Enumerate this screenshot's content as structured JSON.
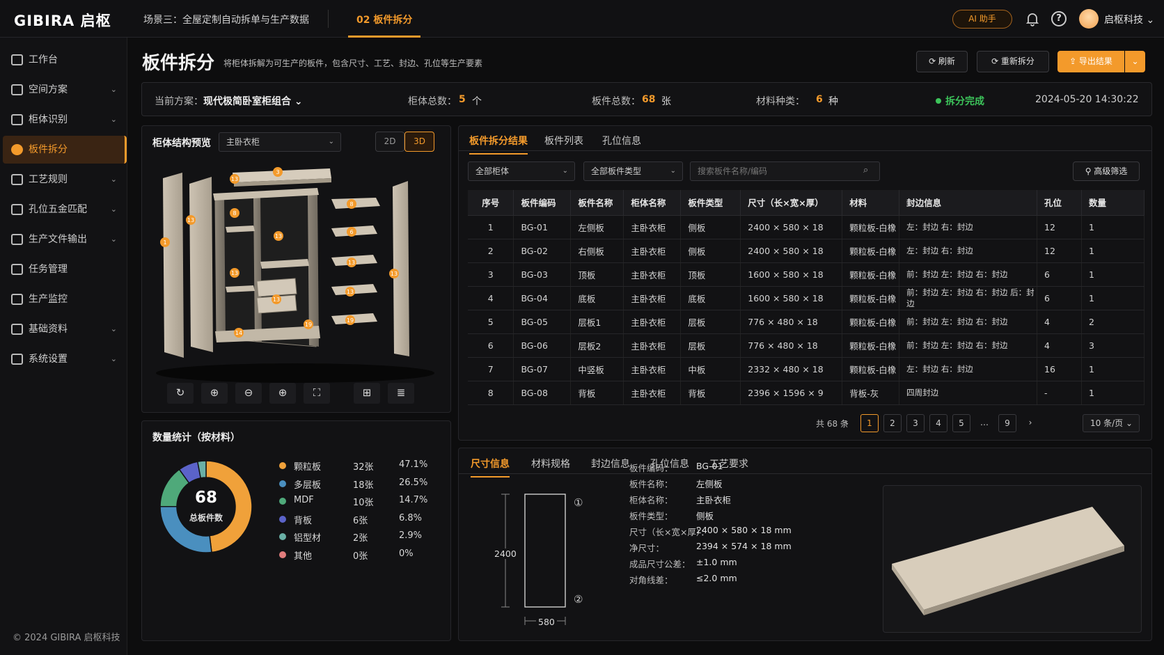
{
  "header": {
    "logo": "GIBIRA 启枢",
    "scene": "场景三：全屋定制自动拆单与生产数据",
    "tab": "02  板件拆分",
    "ai_label": "AI 助手",
    "company": "启枢科技"
  },
  "sidebar": {
    "items": [
      {
        "label": "工作台",
        "chev": ""
      },
      {
        "label": "空间方案",
        "chev": "⌄"
      },
      {
        "label": "柜体识别",
        "chev": "⌄"
      },
      {
        "label": "板件拆分",
        "chev": ""
      },
      {
        "label": "工艺规则",
        "chev": "⌄"
      },
      {
        "label": "孔位五金匹配",
        "chev": "⌄"
      },
      {
        "label": "生产文件输出",
        "chev": "⌄"
      },
      {
        "label": "任务管理",
        "chev": ""
      },
      {
        "label": "生产监控",
        "chev": ""
      },
      {
        "label": "基础资料",
        "chev": "⌄"
      },
      {
        "label": "系统设置",
        "chev": "⌄"
      }
    ],
    "copyright": "© 2024 GIBIRA 启枢科技"
  },
  "page": {
    "title": "板件拆分",
    "desc": "将柜体拆解为可生产的板件，包含尺寸、工艺、封边、孔位等生产要素"
  },
  "toolbar": {
    "refresh": "⟳  刷新",
    "resplit": "⟳  重新拆分",
    "export": "⇪  导出结果",
    "export_more": "⌄"
  },
  "summary": {
    "plan_label": "当前方案：",
    "plan_value": "现代极简卧室柜组合 ⌄",
    "cab_label": "柜体总数：",
    "cab_value": "5",
    "cab_unit": "个",
    "board_label": "板件总数：",
    "board_value": "68",
    "board_unit": "张",
    "mat_label": "材料种类：",
    "mat_value": "6",
    "mat_unit": "种",
    "status": "拆分完成",
    "time": "2024-05-20 14:30:22",
    "status_color": "#3cc35a"
  },
  "preview": {
    "title": "柜体结构预览",
    "select": "主卧衣柜",
    "btn_2d": "2D",
    "btn_3d": "3D",
    "tools": [
      "↻",
      "⊕",
      "⊖",
      "⊕",
      "⛶",
      "⊞",
      "≣"
    ],
    "tags": [
      "3",
      "13",
      "1",
      "13",
      "8",
      "13",
      "8",
      "6",
      "13",
      "13",
      "13",
      "13",
      "19",
      "14",
      "19",
      "13"
    ]
  },
  "stats": {
    "title": "数量统计（按材料）",
    "total": "68",
    "total_label": "总板件数",
    "items": [
      {
        "name": "颗粒板",
        "count": "32张",
        "pct": "47.1%",
        "value": 47.1,
        "color": "#f0a13a"
      },
      {
        "name": "多层板",
        "count": "18张",
        "pct": "26.5%",
        "value": 26.5,
        "color": "#4a8fbf"
      },
      {
        "name": "MDF",
        "count": "10张",
        "pct": "14.7%",
        "value": 14.7,
        "color": "#4fa97a"
      },
      {
        "name": "背板",
        "count": "6张",
        "pct": "6.8%",
        "value": 6.8,
        "color": "#5b63c9"
      },
      {
        "name": "铝型材",
        "count": "2张",
        "pct": "2.9%",
        "value": 2.9,
        "color": "#6ab0a6"
      },
      {
        "name": "其他",
        "count": "0张",
        "pct": "0%",
        "value": 0,
        "color": "#e07c7c"
      }
    ]
  },
  "result": {
    "tabs": [
      "板件拆分结果",
      "板件列表",
      "孔位信息"
    ],
    "filter1": "全部柜体",
    "filter2": "全部板件类型",
    "search_placeholder": "搜索板件名称/编码",
    "adv": "⚲  高级筛选",
    "columns": [
      "序号",
      "板件编码",
      "板件名称",
      "柜体名称",
      "板件类型",
      "尺寸（长×宽×厚）",
      "材料",
      "封边信息",
      "孔位",
      "数量"
    ],
    "rows": [
      [
        "1",
        "BG-01",
        "左侧板",
        "主卧衣柜",
        "侧板",
        "2400 × 580 × 18",
        "颗粒板-白橡",
        "左：封边  右：封边",
        "12",
        "1"
      ],
      [
        "2",
        "BG-02",
        "右侧板",
        "主卧衣柜",
        "侧板",
        "2400 × 580 × 18",
        "颗粒板-白橡",
        "左：封边  右：封边",
        "12",
        "1"
      ],
      [
        "3",
        "BG-03",
        "顶板",
        "主卧衣柜",
        "顶板",
        "1600 × 580 × 18",
        "颗粒板-白橡",
        "前：封边  左：封边  右：封边",
        "6",
        "1"
      ],
      [
        "4",
        "BG-04",
        "底板",
        "主卧衣柜",
        "底板",
        "1600 × 580 × 18",
        "颗粒板-白橡",
        "前：封边 左：封边 右：封边 后：封边",
        "6",
        "1"
      ],
      [
        "5",
        "BG-05",
        "层板1",
        "主卧衣柜",
        "层板",
        "776 × 480 × 18",
        "颗粒板-白橡",
        "前：封边  左：封边  右：封边",
        "4",
        "2"
      ],
      [
        "6",
        "BG-06",
        "层板2",
        "主卧衣柜",
        "层板",
        "776 × 480 × 18",
        "颗粒板-白橡",
        "前：封边  左：封边  右：封边",
        "4",
        "3"
      ],
      [
        "7",
        "BG-07",
        "中竖板",
        "主卧衣柜",
        "中板",
        "2332 × 480 × 18",
        "颗粒板-白橡",
        "左：封边  右：封边",
        "16",
        "1"
      ],
      [
        "8",
        "BG-08",
        "背板",
        "主卧衣柜",
        "背板",
        "2396 × 1596 × 9",
        "背板-灰",
        "四周封边",
        "-",
        "1"
      ]
    ],
    "total": "共 68 条",
    "pages": [
      "‹",
      "1",
      "2",
      "3",
      "4",
      "5",
      "…",
      "9",
      "›"
    ],
    "page_size": "10 条/页 ⌄"
  },
  "detail": {
    "tabs": [
      "尺寸信息",
      "材料规格",
      "封边信息",
      "孔位信息",
      "工艺要求"
    ],
    "dim_h": "2400",
    "dim_w": "580",
    "mark1": "①",
    "mark2": "②",
    "fields": [
      {
        "k": "板件编码：",
        "v": "BG-01"
      },
      {
        "k": "板件名称：",
        "v": "左侧板"
      },
      {
        "k": "柜体名称：",
        "v": "主卧衣柜"
      },
      {
        "k": "板件类型：",
        "v": "侧板"
      },
      {
        "k": "尺寸（长×宽×厚）：",
        "v": "2400 × 580 × 18 mm"
      },
      {
        "k": "净尺寸：",
        "v": "2394 × 574 × 18 mm"
      },
      {
        "k": "成品尺寸公差：",
        "v": "±1.0 mm"
      },
      {
        "k": "对角线差：",
        "v": "≤2.0 mm"
      }
    ]
  }
}
